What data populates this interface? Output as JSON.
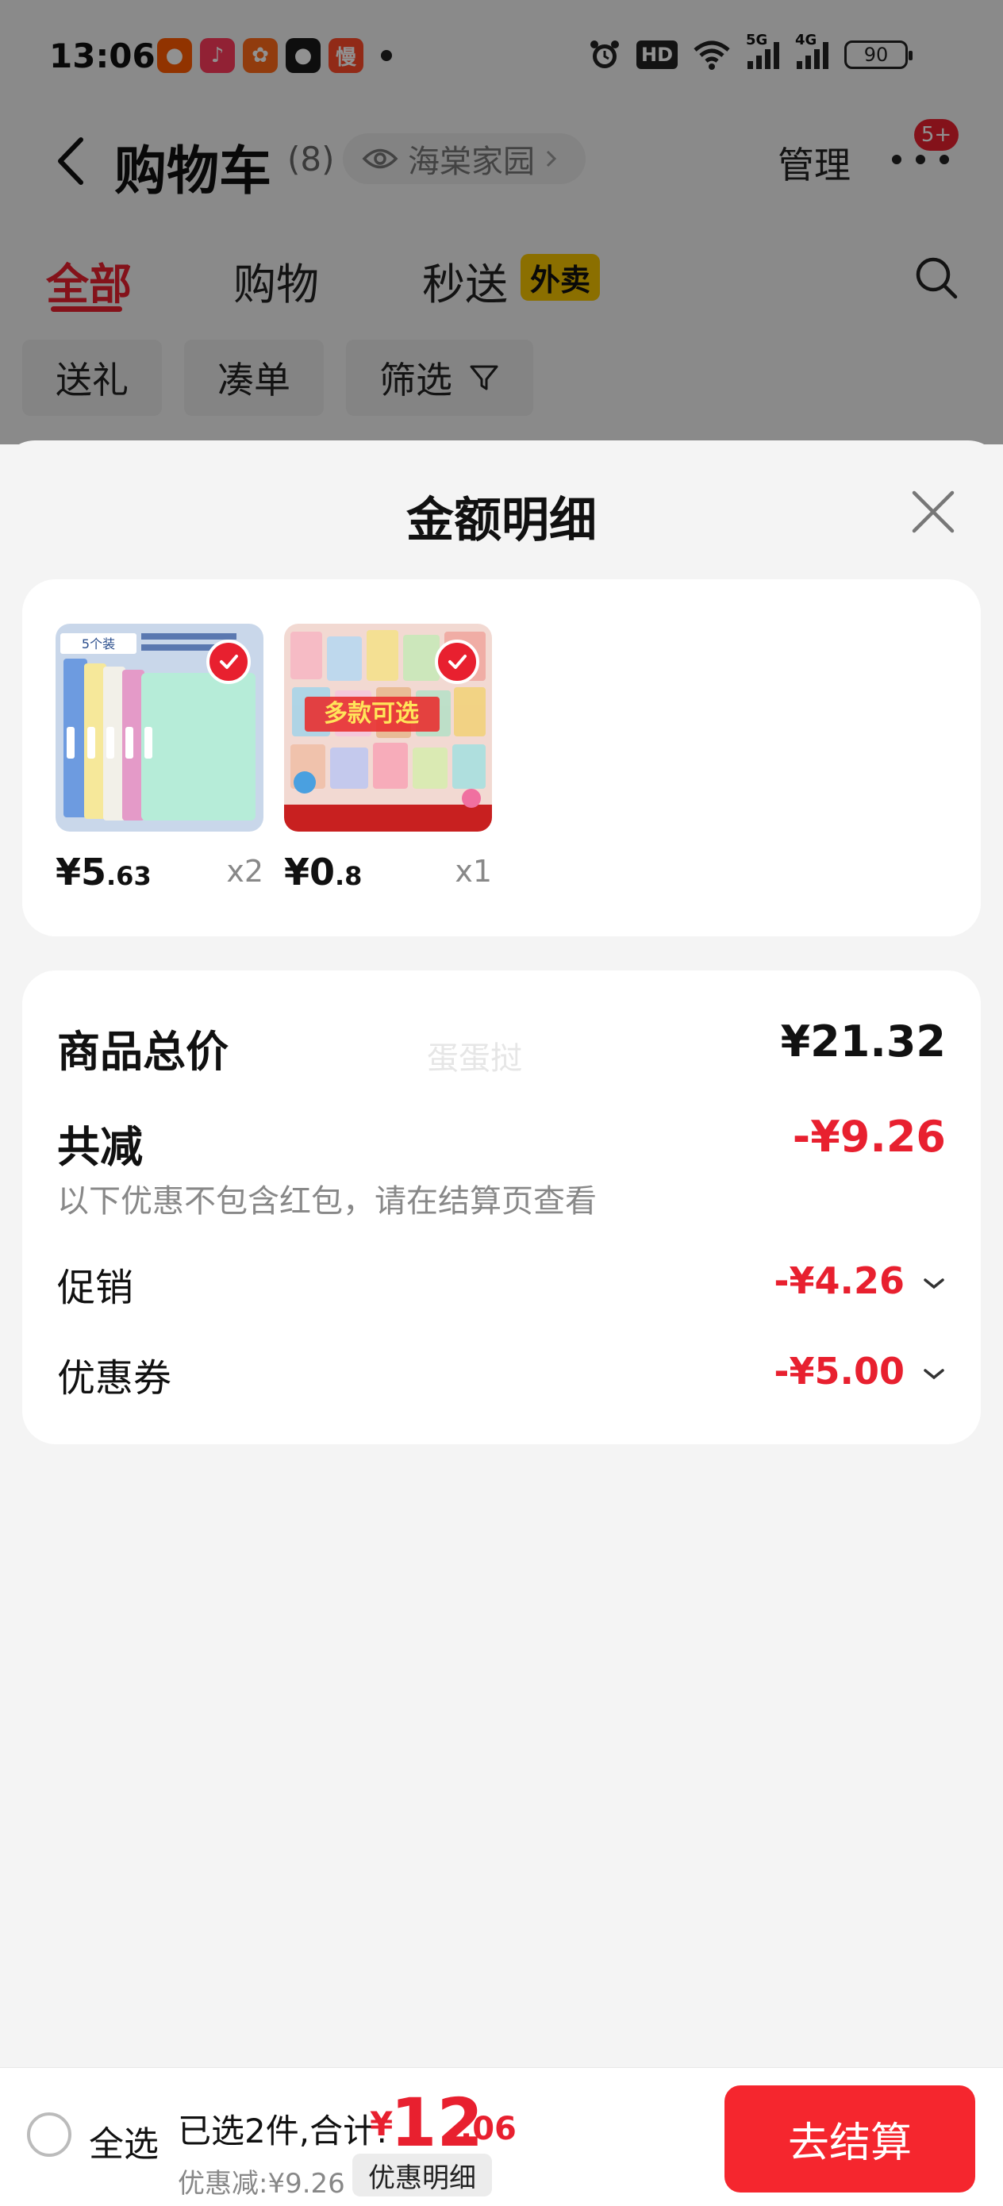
{
  "status_bar": {
    "time": "13:06",
    "app_icons": [
      {
        "name": "shop-app-icon",
        "glyph": "●",
        "color": "#ff5a00"
      },
      {
        "name": "music-app-icon",
        "glyph": "♪",
        "color": "#ff3a5c"
      },
      {
        "name": "community-app-icon",
        "glyph": "✿",
        "color": "#ff6a1a"
      },
      {
        "name": "video-app-icon",
        "glyph": "●",
        "color": "#1a1a1a"
      },
      {
        "name": "reading-app-icon",
        "glyph": "慢",
        "color": "#ff4a2a"
      }
    ],
    "hd_label": "HD",
    "network_5g": "5G",
    "network_4g": "4G",
    "battery": "90"
  },
  "header": {
    "title": "购物车",
    "count": "(8)",
    "address": "海棠家园",
    "manage": "管理",
    "badge": "5+"
  },
  "tabs": [
    {
      "label": "全部",
      "active": true
    },
    {
      "label": "购物",
      "active": false
    },
    {
      "label": "秒送",
      "active": false
    }
  ],
  "tab_tag": "外卖",
  "filter_chips": [
    "送礼",
    "凑单",
    "筛选"
  ],
  "sheet": {
    "title": "金额明细",
    "items": [
      {
        "price_int": "¥5",
        "price_dec": ".63",
        "qty": "x2",
        "thumb_label": "5个装"
      },
      {
        "price_int": "¥0",
        "price_dec": ".8",
        "qty": "x1",
        "thumb_label": "多款可选"
      }
    ],
    "summary": {
      "total_label": "商品总价",
      "total_value": "¥21.32",
      "watermark": "蛋蛋挝",
      "reduce_label": "共减",
      "reduce_value": "-¥9.26",
      "note": "以下优惠不包含红包，请在结算页查看",
      "promo_label": "促销",
      "promo_value": "-¥4.26",
      "coupon_label": "优惠券",
      "coupon_value": "-¥5.00"
    }
  },
  "bottom_bar": {
    "select_all": "全选",
    "selected_text": "已选2件,合计:",
    "currency": "¥",
    "total_int": "12",
    "total_dec": ".06",
    "discount_text": "优惠减:¥9.26",
    "detail_button": "优惠明细",
    "checkout": "去结算"
  },
  "colors": {
    "accent": "#e8202f",
    "checkout": "#f5262e"
  }
}
